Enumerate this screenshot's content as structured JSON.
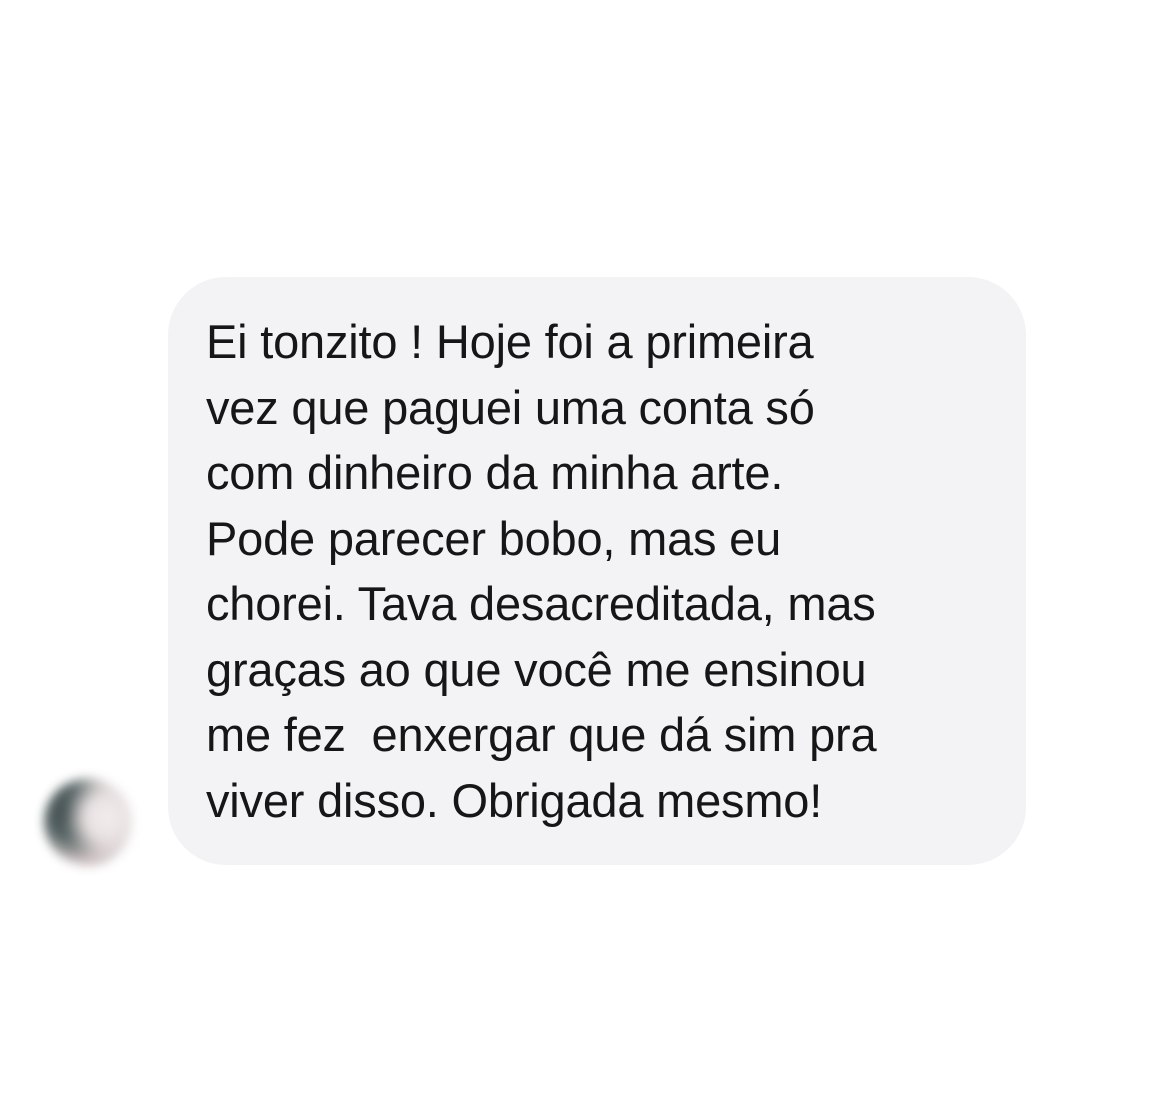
{
  "conversation": {
    "incoming_message": {
      "lines": [
        "Ei tonzito ! Hoje foi a primeira",
        "vez que paguei uma conta só",
        "com dinheiro da minha arte.",
        "Pode parecer bobo, mas eu",
        "chorei. Tava desacreditada, mas",
        "graças ao que você me ensinou",
        "me fez  enxergar que dá sim pra",
        "viver disso. Obrigada mesmo!"
      ]
    },
    "colors": {
      "bubble_background": "#f3f3f6",
      "text": "#161616",
      "page_background": "#ffffff"
    }
  }
}
